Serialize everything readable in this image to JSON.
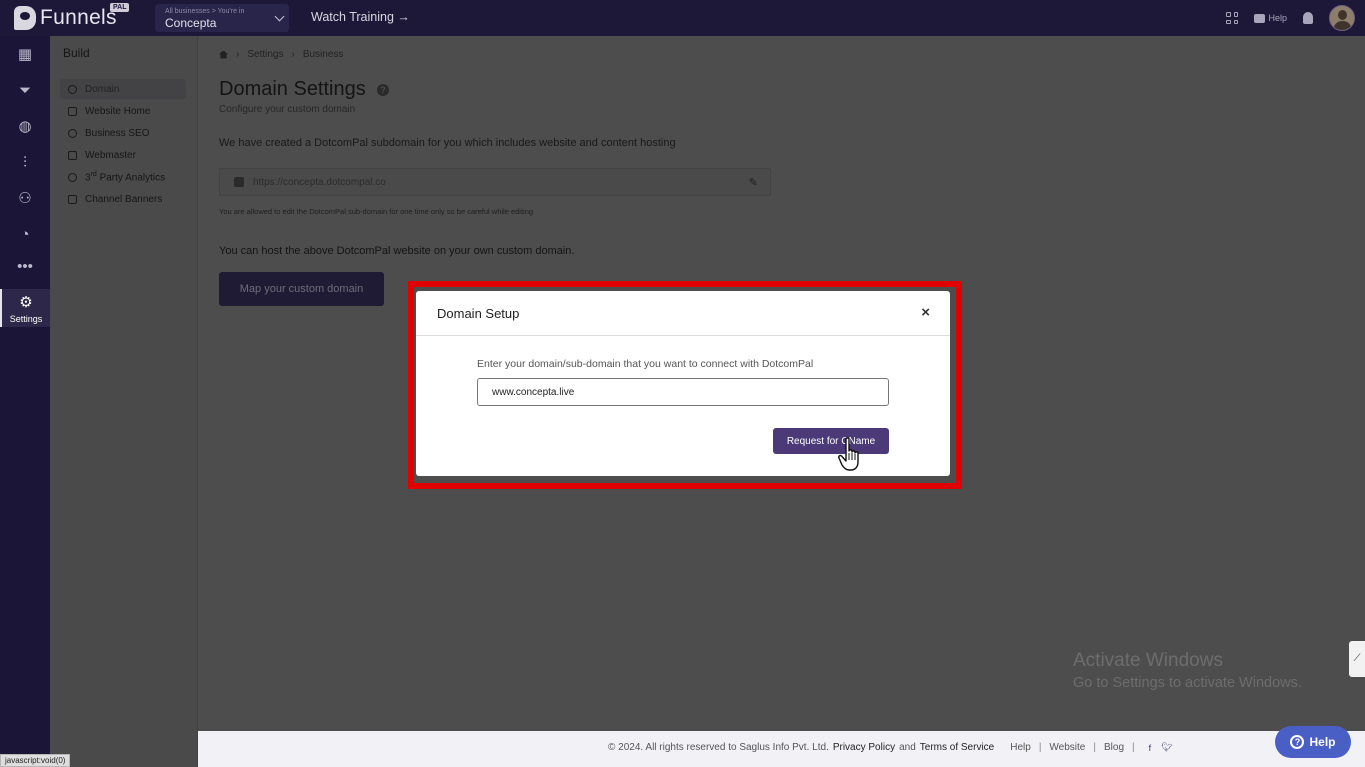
{
  "topbar": {
    "logo_text": "Funnels",
    "logo_badge": "PAL",
    "business_switcher": {
      "small_label": "All businesses > You're in",
      "name": "Concepta"
    },
    "watch_training": "Watch Training →",
    "help_label": "Help"
  },
  "rail": {
    "settings_label": "Settings"
  },
  "sidebar": {
    "title": "Build",
    "items": [
      {
        "label": "Domain"
      },
      {
        "label": "Website Home"
      },
      {
        "label": "Business SEO"
      },
      {
        "label": "Webmaster"
      },
      {
        "label": "3rd Party Analytics"
      },
      {
        "label": "Channel Banners"
      }
    ]
  },
  "breadcrumb": {
    "items": [
      "Settings",
      "Business"
    ]
  },
  "page": {
    "title": "Domain Settings",
    "subtitle": "Configure your custom domain",
    "intro": "We have created a DotcomPal subdomain for you which includes website and content hosting",
    "subdomain_value": "https://concepta.dotcompal.co",
    "note": "You are allowed to edit the DotcomPal sub-domain for one time only so be careful while editing",
    "host_text": "You can host the above DotcomPal website on your own custom domain.",
    "map_button": "Map your custom domain"
  },
  "modal": {
    "title": "Domain Setup",
    "close_glyph": "×",
    "label": "Enter your domain/sub-domain that you want to connect with DotcomPal",
    "input_value": "www.concepta.live",
    "submit_label": "Request for CName",
    "highlight_color": "#e00000"
  },
  "watermark": {
    "line1": "Activate Windows",
    "line2": "Go to Settings to activate Windows."
  },
  "footer": {
    "copyright": "©  2024. All rights reserved to Saglus Info Pvt. Ltd.",
    "privacy": "Privacy Policy",
    "and": "and",
    "terms": "Terms of Service",
    "links": [
      "Help",
      "Website",
      "Blog"
    ],
    "social": [
      "f",
      "t"
    ]
  },
  "help_float": {
    "label": "Help"
  },
  "status_bar": "javascript:void(0)",
  "colors": {
    "brand_dark": "#1d1838",
    "accent": "#4c3a78",
    "help_blue": "#4a5fc6"
  }
}
